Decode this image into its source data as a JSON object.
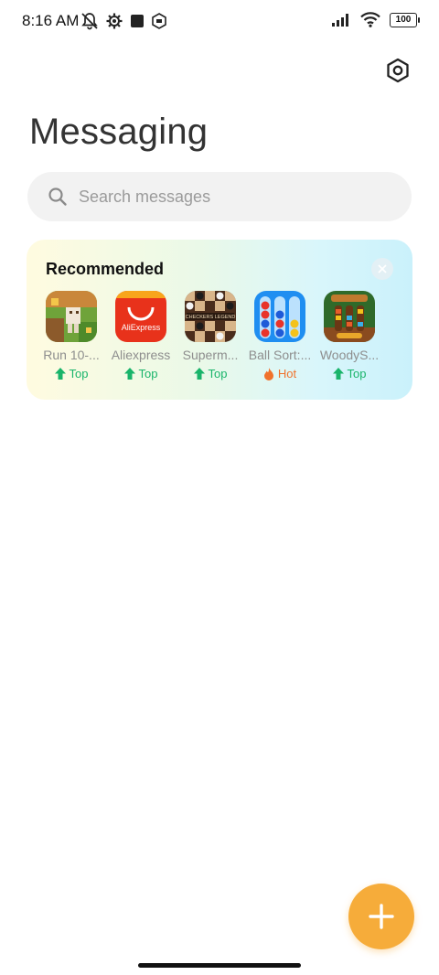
{
  "status_bar": {
    "time": "8:16 AM",
    "battery": "100",
    "icons_left": [
      "mute-icon",
      "gear-status-icon",
      "square-icon",
      "shield-status-icon"
    ],
    "icons_right": [
      "signal-icon",
      "wifi-icon",
      "battery-icon"
    ]
  },
  "header": {
    "title": "Messaging",
    "settings_icon": "settings-hexagon-icon"
  },
  "search": {
    "placeholder": "Search messages",
    "icon": "search-icon"
  },
  "recommended": {
    "title": "Recommended",
    "close_icon": "close-icon",
    "apps": [
      {
        "name": "Run 10-...",
        "badge": "Top",
        "badge_type": "top"
      },
      {
        "name": "Aliexpress",
        "badge": "Top",
        "badge_type": "top",
        "icon_text": "AliExpress"
      },
      {
        "name": "Superm...",
        "badge": "Top",
        "badge_type": "top",
        "icon_text": "CHECKERS LEGEND"
      },
      {
        "name": "Ball Sort:...",
        "badge": "Hot",
        "badge_type": "hot"
      },
      {
        "name": "WoodyS...",
        "badge": "Top",
        "badge_type": "top"
      }
    ]
  },
  "fab": {
    "icon": "plus-icon"
  },
  "colors": {
    "accent": "#f6ac3a",
    "top_badge": "#19b46a",
    "hot_badge": "#f0722c"
  }
}
